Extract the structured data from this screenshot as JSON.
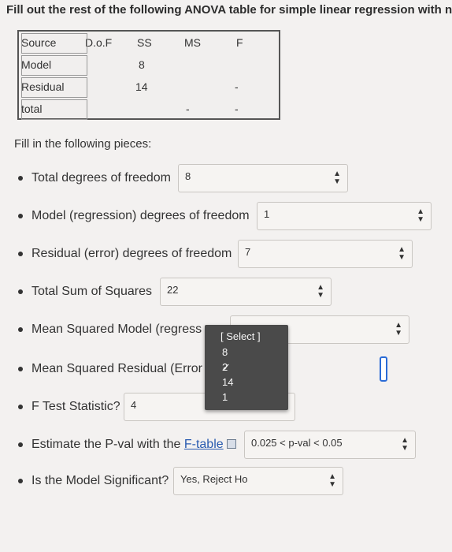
{
  "heading": "Fill out the rest of the following ANOVA table for simple linear regression with n",
  "anova": {
    "headers": [
      "Source",
      "D.o.F",
      "SS",
      "MS",
      "F"
    ],
    "rows": [
      {
        "source": "Model",
        "ss": "8"
      },
      {
        "source": "Residual",
        "ss": "14",
        "f": "-"
      },
      {
        "source": "total",
        "ms": "-",
        "f": "-"
      }
    ]
  },
  "fill_label": "Fill in the following pieces:",
  "questions": [
    {
      "label": "Total degrees of freedom",
      "answer": "8"
    },
    {
      "label": "Model (regression) degrees of freedom",
      "answer": "1"
    },
    {
      "label": "Residual (error) degrees of freedom",
      "answer": "7"
    },
    {
      "label": "Total Sum of Squares",
      "answer": "22"
    },
    {
      "label": "Mean Squared Model (regress",
      "answer": ""
    },
    {
      "label": "Mean Squared Residual (Error",
      "answer": ""
    },
    {
      "label": "F Test Statistic?",
      "answer": "4"
    },
    {
      "label_prefix": "Estimate the P-val with the ",
      "label_link": "F-table",
      "answer": "0.025 < p-val < 0.05"
    },
    {
      "label": "Is the Model Significant?",
      "answer": "Yes, Reject Ho"
    }
  ],
  "dropdown": {
    "placeholder": "[ Select ]",
    "options": [
      "8",
      "2",
      "14",
      "1"
    ],
    "checked": "2"
  }
}
